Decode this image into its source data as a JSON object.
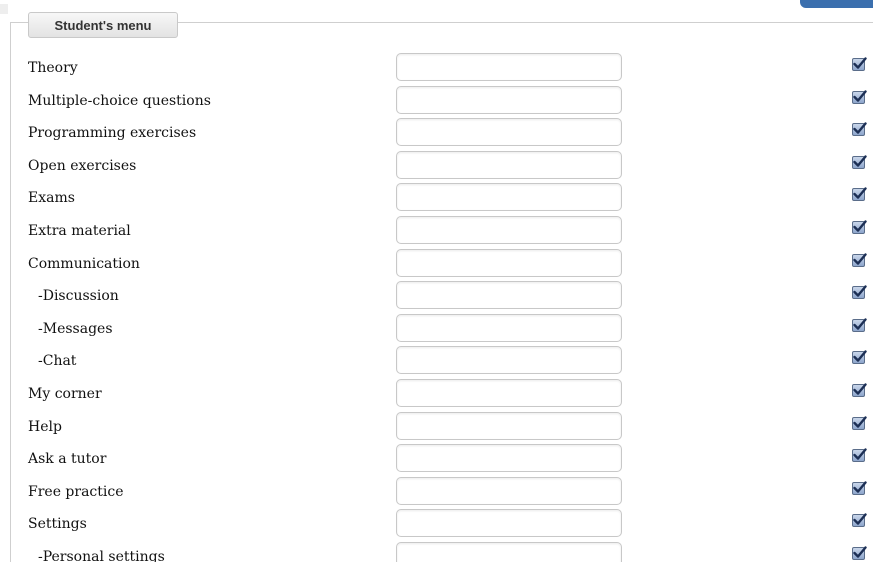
{
  "menu": {
    "legend": "Student's menu",
    "items": [
      {
        "label": "Theory",
        "value": "",
        "checked": true,
        "sub": false
      },
      {
        "label": "Multiple-choice questions",
        "value": "",
        "checked": true,
        "sub": false
      },
      {
        "label": "Programming exercises",
        "value": "",
        "checked": true,
        "sub": false
      },
      {
        "label": "Open exercises",
        "value": "",
        "checked": true,
        "sub": false
      },
      {
        "label": "Exams",
        "value": "",
        "checked": true,
        "sub": false
      },
      {
        "label": "Extra material",
        "value": "",
        "checked": true,
        "sub": false
      },
      {
        "label": "Communication",
        "value": "",
        "checked": true,
        "sub": false
      },
      {
        "label": "-Discussion",
        "value": "",
        "checked": true,
        "sub": true
      },
      {
        "label": "-Messages",
        "value": "",
        "checked": true,
        "sub": true
      },
      {
        "label": "-Chat",
        "value": "",
        "checked": true,
        "sub": true
      },
      {
        "label": "My corner",
        "value": "",
        "checked": true,
        "sub": false
      },
      {
        "label": "Help",
        "value": "",
        "checked": true,
        "sub": false
      },
      {
        "label": "Ask a tutor",
        "value": "",
        "checked": true,
        "sub": false
      },
      {
        "label": "Free practice",
        "value": "",
        "checked": true,
        "sub": false
      },
      {
        "label": "Settings",
        "value": "",
        "checked": true,
        "sub": false
      },
      {
        "label": "-Personal settings",
        "value": "",
        "checked": true,
        "sub": true
      }
    ]
  },
  "colors": {
    "checkbox_fill": "#8ea6cc",
    "checkmark": "#1c2f55",
    "corner_button": "#3b6fae"
  },
  "icons": {
    "checkbox": "checkbox-checked-icon"
  }
}
